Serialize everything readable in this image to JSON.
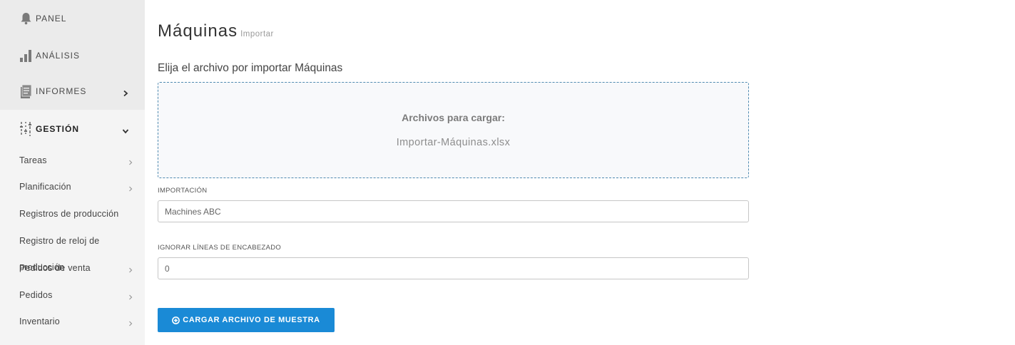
{
  "sidebar": {
    "top": [
      {
        "label": "PANEL",
        "icon": "bell-icon"
      },
      {
        "label": "ANÁLISIS",
        "icon": "bar-chart-icon"
      },
      {
        "label": "INFORMES",
        "icon": "document-icon"
      }
    ],
    "section": {
      "label": "GESTIÓN",
      "icon": "sliders-icon"
    },
    "items": [
      {
        "label": "Tareas"
      },
      {
        "label": "Planificación"
      },
      {
        "label": "Registros de producción"
      },
      {
        "label": "Registro de reloj de"
      },
      {
        "label": "producción"
      },
      {
        "label": "Pedidos de venta"
      },
      {
        "label": "Pedidos"
      },
      {
        "label": "Inventario"
      }
    ]
  },
  "page": {
    "title": "Máquinas",
    "subtitle": "Importar",
    "choose_label": "Elija el archivo por importar Máquinas"
  },
  "dropzone": {
    "title": "Archivos para cargar:",
    "file": "Importar-Máquinas.xlsx"
  },
  "form": {
    "import_label": "IMPORTACIÓN",
    "import_value": "Machines ABC",
    "skip_label": "IGNORAR LÍNEAS DE ENCABEZADO",
    "skip_value": "0",
    "button_label": "CARGAR ARCHIVO DE MUESTRA"
  },
  "colors": {
    "accent": "#1a8ad6",
    "sidebar_bg": "#f4f4f4",
    "dropzone_border": "#4f8ab0"
  }
}
